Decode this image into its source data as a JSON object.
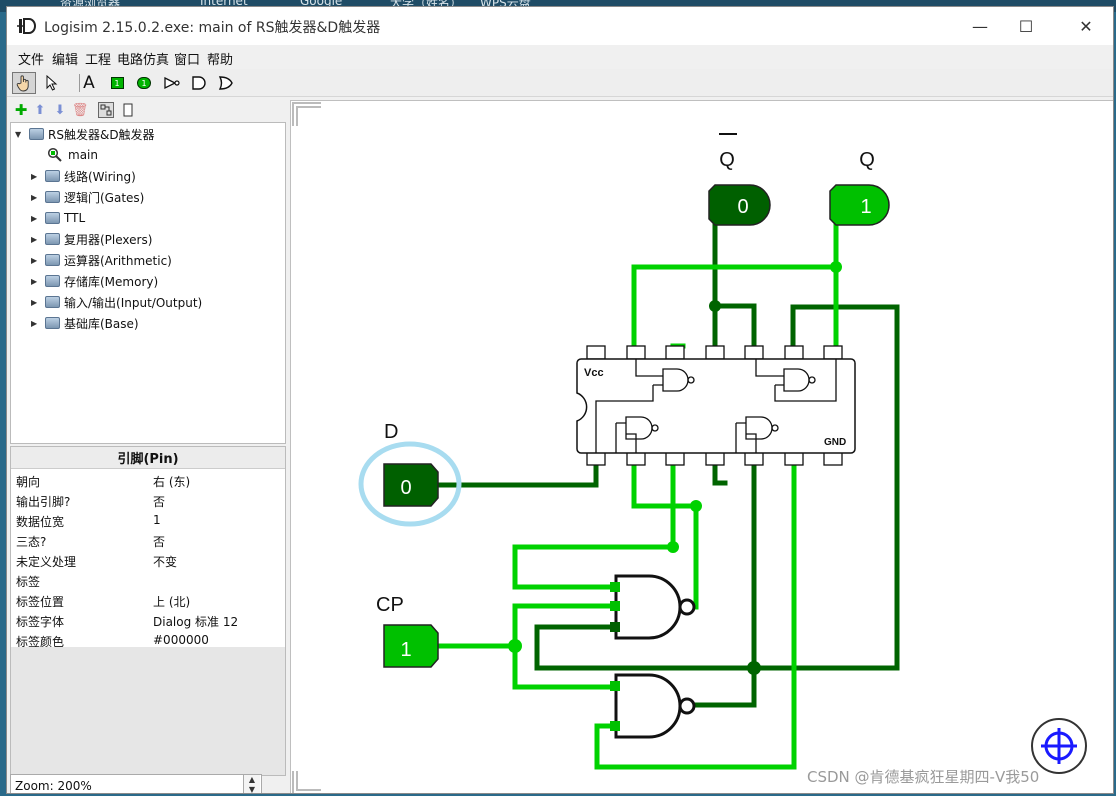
{
  "desktop": {
    "background_strip_text": [
      "资源浏览器",
      "Internet",
      "Google",
      "大学（姓名）",
      "WPS云盘"
    ]
  },
  "window": {
    "title": "Logisim 2.15.0.2.exe: main of RS触发器&D触发器",
    "minimize": "—",
    "maximize": "☐",
    "close": "✕"
  },
  "menu": [
    "文件",
    "编辑",
    "工程",
    "电路仿真",
    "窗口",
    "帮助"
  ],
  "toolbar": {
    "tools": [
      "hand-poke-tool",
      "select-arrow-tool",
      "text-tool",
      "input-pin-tool",
      "output-pin-tool",
      "not-gate-tool",
      "and-gate-tool",
      "or-gate-tool"
    ],
    "text_tool_label": "A",
    "input_pin_label": "1",
    "output_pin_label": "1"
  },
  "tree_toolbar": [
    "add-circuit-icon",
    "move-up-icon",
    "move-down-icon",
    "delete-icon",
    "layout-view-icon",
    "appearance-view-icon"
  ],
  "tree": {
    "project": "RS触发器&D触发器",
    "main": "main",
    "libraries": [
      "线路(Wiring)",
      "逻辑门(Gates)",
      "TTL",
      "复用器(Plexers)",
      "运算器(Arithmetic)",
      "存储库(Memory)",
      "输入/输出(Input/Output)",
      "基础库(Base)"
    ]
  },
  "properties": {
    "title": "引脚(Pin)",
    "rows": [
      {
        "key": "朝向",
        "value": "右 (东)"
      },
      {
        "key": "输出引脚?",
        "value": "否"
      },
      {
        "key": "数据位宽",
        "value": "1"
      },
      {
        "key": "三态?",
        "value": "否"
      },
      {
        "key": "未定义处理",
        "value": "不变"
      },
      {
        "key": "标签",
        "value": ""
      },
      {
        "key": "标签位置",
        "value": "上 (北)"
      },
      {
        "key": "标签字体",
        "value": "Dialog 标准 12"
      },
      {
        "key": "标签颜色",
        "value": "#000000"
      }
    ]
  },
  "zoom": "Zoom: 200%",
  "circuit": {
    "label_d": "D",
    "label_cp": "CP",
    "label_qbar": "Q",
    "label_q": "Q",
    "pin_d_value": "0",
    "pin_cp_value": "1",
    "out_qbar_value": "0",
    "out_q_value": "1",
    "chip_vcc": "Vcc",
    "chip_gnd": "GND"
  },
  "colors": {
    "wire_high": "#00d200",
    "wire_low": "#006400",
    "pin_high": "#00c000",
    "pin_low": "#006000",
    "selection": "#a8dcf0"
  },
  "watermark": "CSDN @肯德基疯狂星期四-V我50"
}
